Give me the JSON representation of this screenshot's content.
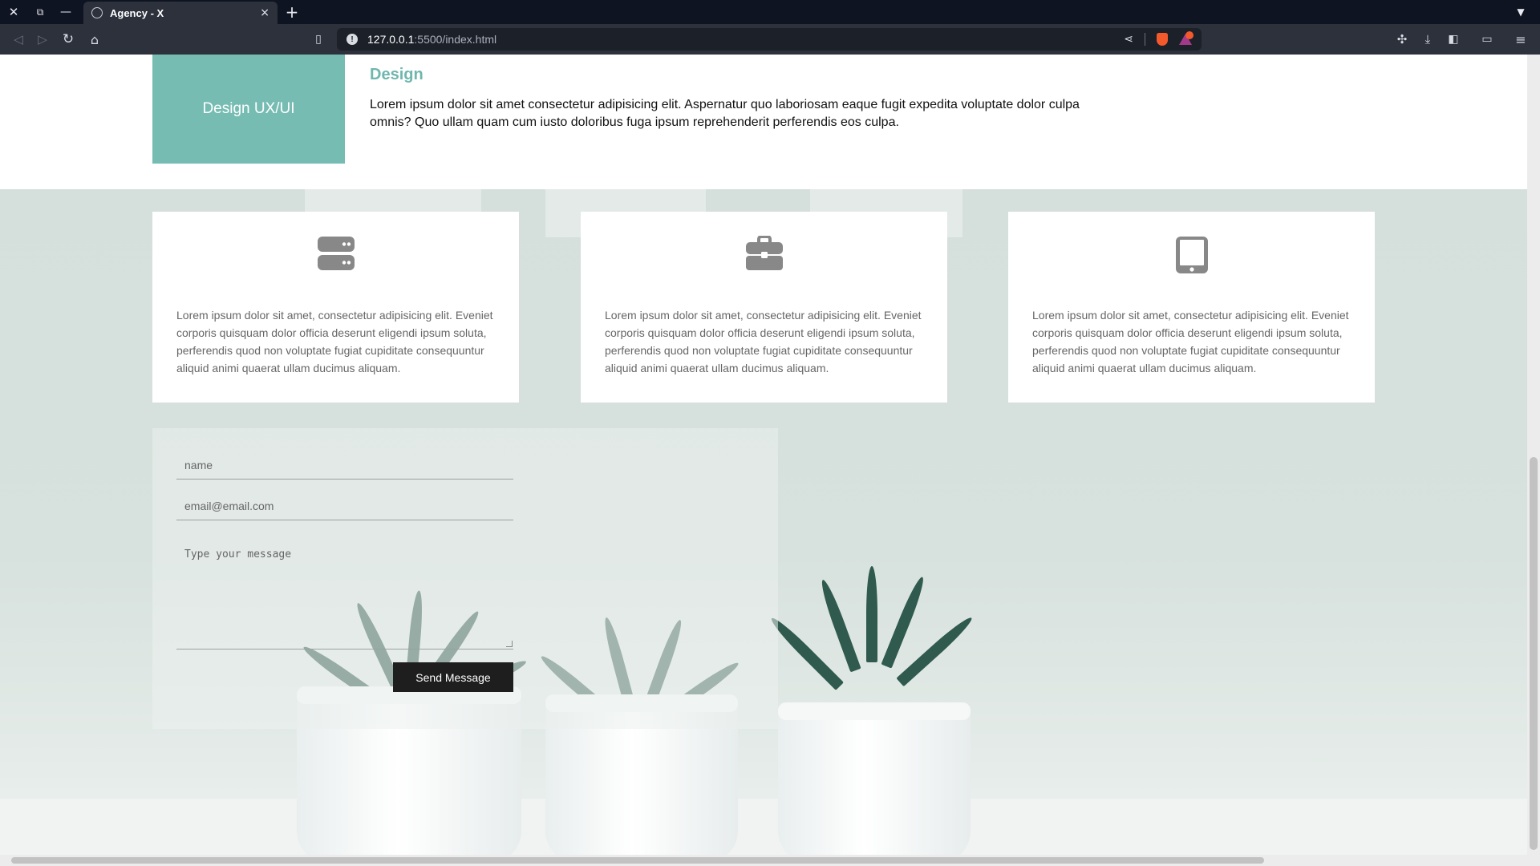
{
  "browser": {
    "tab_title": "Agency - X",
    "tab_close": "×",
    "new_tab": "+",
    "url_host": "127.0.0.1",
    "url_path": ":5500/index.html"
  },
  "design_section": {
    "box_label": "Design UX/UI",
    "title": "Design",
    "text": "Lorem ipsum dolor sit amet consectetur adipisicing elit. Aspernatur quo laboriosam eaque fugit expedita voluptate dolor culpa omnis? Quo ullam quam cum iusto doloribus fuga ipsum reprehenderit perferendis eos culpa."
  },
  "cards": [
    {
      "icon": "server-icon",
      "text": "Lorem ipsum dolor sit amet, consectetur adipisicing elit. Eveniet corporis quisquam dolor officia deserunt eligendi ipsum soluta, perferendis quod non voluptate fugiat cupiditate consequuntur aliquid animi quaerat ullam ducimus aliquam."
    },
    {
      "icon": "briefcase-icon",
      "text": "Lorem ipsum dolor sit amet, consectetur adipisicing elit. Eveniet corporis quisquam dolor officia deserunt eligendi ipsum soluta, perferendis quod non voluptate fugiat cupiditate consequuntur aliquid animi quaerat ullam ducimus aliquam."
    },
    {
      "icon": "tablet-icon",
      "text": "Lorem ipsum dolor sit amet, consectetur adipisicing elit. Eveniet corporis quisquam dolor officia deserunt eligendi ipsum soluta, perferendis quod non voluptate fugiat cupiditate consequuntur aliquid animi quaerat ullam ducimus aliquam."
    }
  ],
  "form": {
    "name_placeholder": "name",
    "email_placeholder": "email@email.com",
    "message_placeholder": "Type your message",
    "send_label": "Send Message"
  },
  "colors": {
    "accent": "#76bcb2",
    "button": "#1e1e1e",
    "card_icon": "#888888"
  }
}
